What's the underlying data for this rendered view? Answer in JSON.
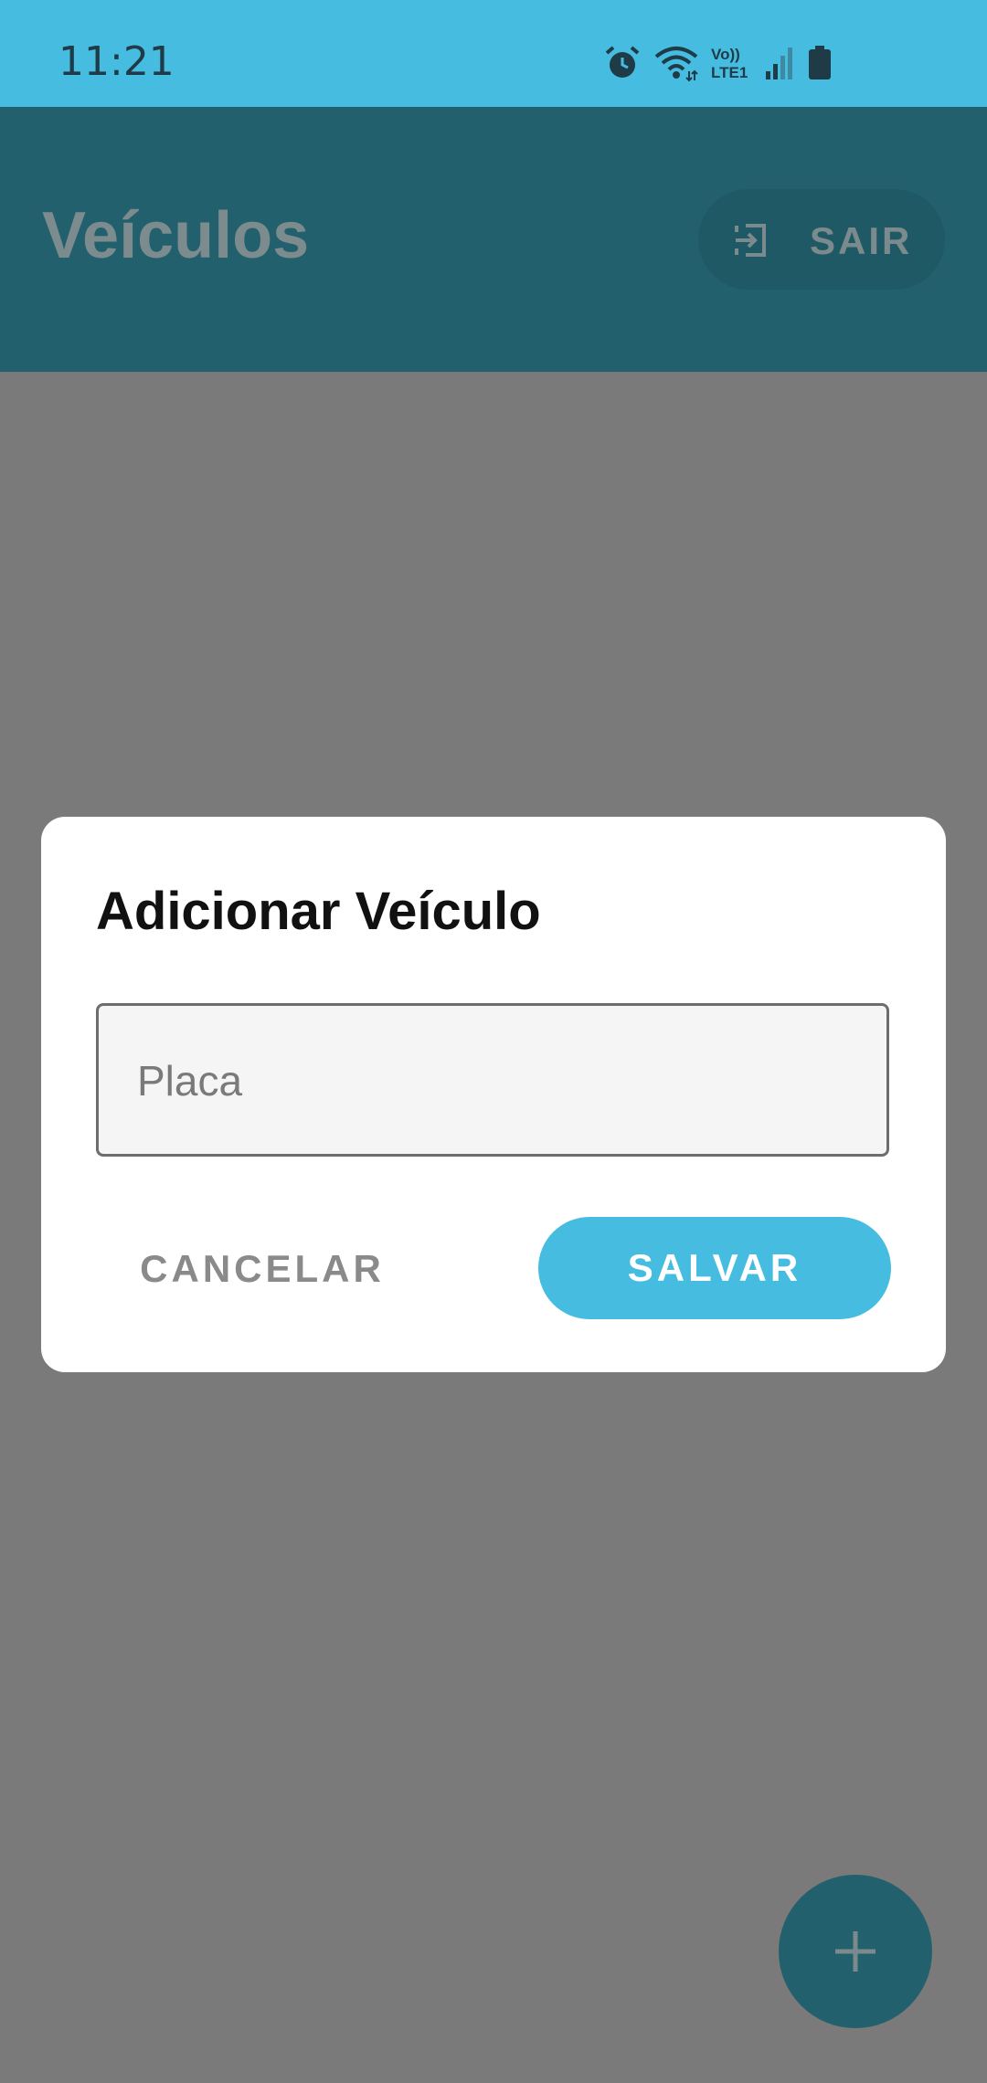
{
  "status_bar": {
    "time": "11:21",
    "icons": [
      "alarm-icon",
      "wifi-icon",
      "volte-lte-icon",
      "signal-icon",
      "battery-icon"
    ],
    "volte_text_top": "Vo))",
    "volte_text_bottom": "LTE1"
  },
  "app_bar": {
    "title": "Veículos",
    "exit_label": "SAIR",
    "exit_icon": "exit-icon"
  },
  "dialog": {
    "title": "Adicionar Veículo",
    "plate_input": {
      "value": "",
      "placeholder": "Placa"
    },
    "cancel_label": "CANCELAR",
    "save_label": "SALVAR"
  },
  "fab": {
    "icon": "plus-icon"
  },
  "colors": {
    "accent": "#46bde0",
    "app_bar_dimmed": "#23606d",
    "scrim": "#7a7a7a"
  }
}
